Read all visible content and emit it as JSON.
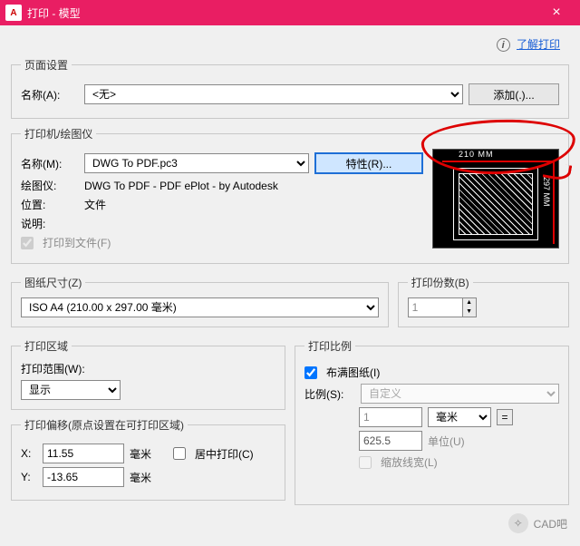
{
  "titlebar": {
    "app_icon_text": "A",
    "title": "打印 - 模型",
    "close": "×"
  },
  "help": {
    "info_glyph": "i",
    "link": "了解打印"
  },
  "page_setup": {
    "legend": "页面设置",
    "name_label": "名称(A):",
    "name_value": "<无>",
    "add_button": "添加(.)..."
  },
  "printer": {
    "legend": "打印机/绘图仪",
    "name_label": "名称(M):",
    "name_value": "DWG To PDF.pc3",
    "props_button": "特性(R)...",
    "plotter_label": "绘图仪:",
    "plotter_value": "DWG To PDF - PDF ePlot - by Autodesk",
    "where_label": "位置:",
    "where_value": "文件",
    "desc_label": "说明:",
    "to_file_label": "打印到文件(F)",
    "preview_top": "210 MM",
    "preview_right": "297 MM"
  },
  "paper": {
    "legend": "图纸尺寸(Z)",
    "value": "ISO A4 (210.00 x 297.00 毫米)"
  },
  "copies": {
    "legend": "打印份数(B)",
    "value": "1"
  },
  "area": {
    "legend": "打印区域",
    "what_label": "打印范围(W):",
    "what_value": "显示"
  },
  "scale": {
    "legend": "打印比例",
    "fit_label": "布满图纸(I)",
    "scale_label": "比例(S):",
    "scale_value": "自定义",
    "num": "1",
    "unit": "毫米",
    "den": "625.5",
    "den_unit": "单位(U)",
    "lw_label": "缩放线宽(L)"
  },
  "offset": {
    "legend": "打印偏移(原点设置在可打印区域)",
    "x_label": "X:",
    "x_value": "11.55",
    "x_unit": "毫米",
    "y_label": "Y:",
    "y_value": "-13.65",
    "y_unit": "毫米",
    "center_label": "居中打印(C)"
  },
  "watermark": {
    "icon": "✧",
    "text": "CAD吧"
  }
}
